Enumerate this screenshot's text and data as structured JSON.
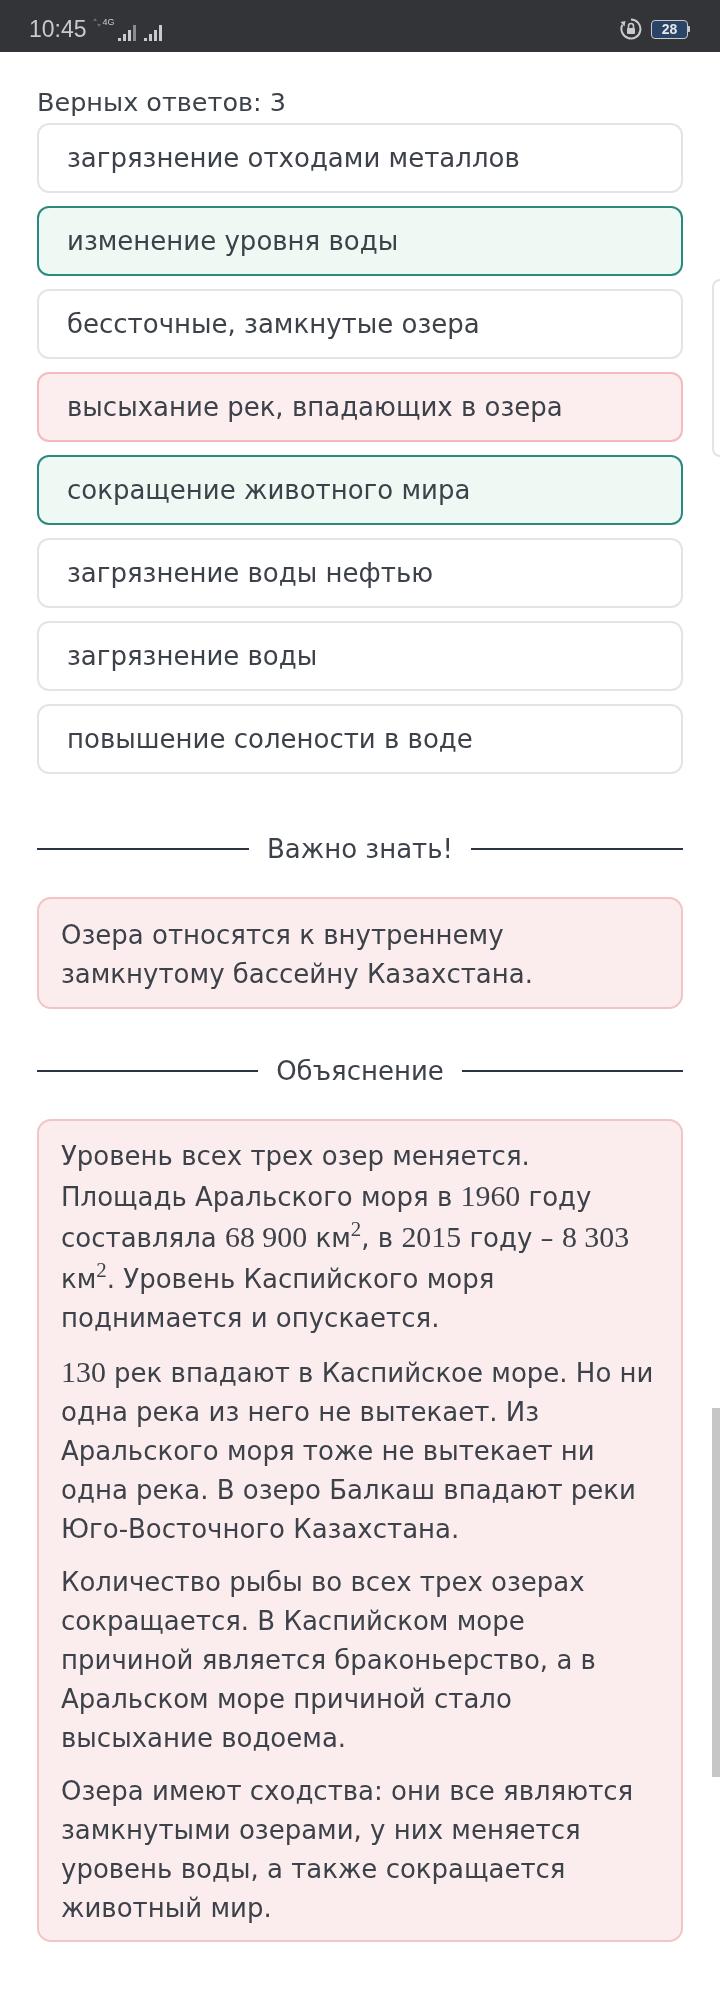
{
  "status_bar": {
    "time": "10:45",
    "network": "4G",
    "battery": "28"
  },
  "question": {
    "correct_count": "Верных ответов: 3",
    "options": [
      {
        "text": "загрязнение отходами металлов",
        "selected": false
      },
      {
        "text": "изменение уровня воды",
        "selected": true,
        "correct": true
      },
      {
        "text": "бессточные, замкнутые озера",
        "selected": false
      },
      {
        "text": "высыхание рек, впадающих в озера",
        "selected": true,
        "correct": false
      },
      {
        "text": "сокращение животного мира",
        "selected": true,
        "correct": true
      },
      {
        "text": "загрязнение воды нефтью",
        "selected": false
      },
      {
        "text": "загрязнение воды",
        "selected": false
      },
      {
        "text": "повышение солености в воде",
        "selected": false
      }
    ]
  },
  "important": {
    "title": "Важно знать!",
    "text": "Озера относятся к внутреннему замкнутому бассейну Казахстана."
  },
  "explanation": {
    "title": "Объяснение",
    "paragraphs": [
      {
        "parts": [
          {
            "kind": "text",
            "text": "Уровень всех трех озер меняется. Площадь Аральского моря в "
          },
          {
            "kind": "math",
            "text": "1960"
          },
          {
            "kind": "text",
            "text": " году составляла "
          },
          {
            "kind": "math",
            "text": "68 900"
          },
          {
            "kind": "text",
            "text": " км"
          },
          {
            "kind": "math",
            "text": "$^{2}$"
          },
          {
            "kind": "text",
            "text": ", в "
          },
          {
            "kind": "math",
            "text": "2015"
          },
          {
            "kind": "text",
            "text": " году – "
          },
          {
            "kind": "math",
            "text": "8 303"
          },
          {
            "kind": "text",
            "text": " км"
          },
          {
            "kind": "math",
            "text": "$^{2}$"
          },
          {
            "kind": "text",
            "text": ". Уровень Каспийского моря поднимается и опускается."
          }
        ]
      },
      {
        "parts": [
          {
            "kind": "math",
            "text": "130"
          },
          {
            "kind": "text",
            "text": " рек впадают в Каспийское море. Но ни одна река из него не вытекает. Из Аральского моря тоже не вытекает ни одна река. В озеро Балкаш впадают реки Юго-Восточного Казахстана."
          }
        ]
      },
      {
        "parts": [
          {
            "kind": "text",
            "text": "Количество рыбы во всех трех озерах сокращается. В Каспийском море причиной является браконьерство, а в Аральском море причиной стало высыхание водоема."
          }
        ]
      },
      {
        "parts": [
          {
            "kind": "text",
            "text": "Озера имеют сходства: они все являются замкнутыми озерами, у них меняется уровень воды, а также сокращается животный мир."
          }
        ]
      }
    ]
  }
}
